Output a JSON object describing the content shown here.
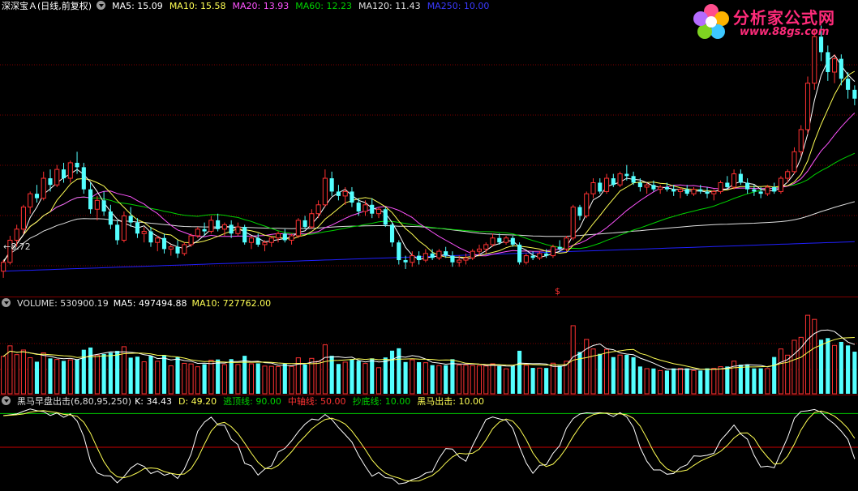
{
  "main_header": {
    "stock_name": "深深宝Ａ(日线,前复权)",
    "ma5": "MA5: 15.09",
    "ma10": "MA10: 15.58",
    "ma20": "MA20: 13.93",
    "ma60": "MA60: 12.23",
    "ma120": "MA120: 11.43",
    "ma250": "MA250: 10.00"
  },
  "volume_header": {
    "label": "VOLUME: 530900.19",
    "ma5": "MA5: 497494.88",
    "ma10": "MA10: 727762.00"
  },
  "indicator_header": {
    "label": "黑马早盘出击(6,80,95,250)",
    "k": "K: 34.43",
    "d": "D: 49.20",
    "top_line": "逃顶线: 90.00",
    "mid_line": "中轴线: 50.00",
    "bottom_line": "抄底线: 10.00",
    "signal": "黑马出击: 10.00"
  },
  "price_low_label": "8.72",
  "marker_label": "$",
  "logo": {
    "name": "分析家公式网",
    "url": "www.88gs.com"
  },
  "colors": {
    "up": "#ff3232",
    "down": "#54ffff",
    "ma5": "#ffffff",
    "ma10": "#ffff54",
    "ma20": "#ff54ff",
    "ma60": "#00d200",
    "ma120": "#e0e0e0",
    "ma250": "#2020ff",
    "grid": "#800000",
    "k_line": "#ffffff",
    "d_line": "#ffff54",
    "top_line": "#00c800",
    "mid_line": "#c80000"
  },
  "chart_data": [
    {
      "type": "candlestick",
      "title": "深深宝Ａ(日线,前复权)",
      "price_low": 8.72,
      "candles_ohlc": [
        [
          9.0,
          9.5,
          8.7,
          9.4
        ],
        [
          9.4,
          10.6,
          9.3,
          10.4
        ],
        [
          10.4,
          11.1,
          10.1,
          10.9
        ],
        [
          10.9,
          12.0,
          10.7,
          11.9
        ],
        [
          11.9,
          12.6,
          11.6,
          12.5
        ],
        [
          12.5,
          12.9,
          12.1,
          12.3
        ],
        [
          12.3,
          13.5,
          12.2,
          13.2
        ],
        [
          13.2,
          13.6,
          12.6,
          12.9
        ],
        [
          12.9,
          13.8,
          12.8,
          13.6
        ],
        [
          13.6,
          13.9,
          13.0,
          13.2
        ],
        [
          13.2,
          14.0,
          13.0,
          13.9
        ],
        [
          13.9,
          14.4,
          13.4,
          13.7
        ],
        [
          13.7,
          13.9,
          12.5,
          12.7
        ],
        [
          12.7,
          13.0,
          11.6,
          11.8
        ],
        [
          11.8,
          12.4,
          11.3,
          12.2
        ],
        [
          12.2,
          12.6,
          11.5,
          11.7
        ],
        [
          11.7,
          12.0,
          10.9,
          11.1
        ],
        [
          11.1,
          11.3,
          10.2,
          10.4
        ],
        [
          10.4,
          11.7,
          10.3,
          11.5
        ],
        [
          11.5,
          11.9,
          11.0,
          11.2
        ],
        [
          11.2,
          11.4,
          10.5,
          10.7
        ],
        [
          10.7,
          11.0,
          10.3,
          10.8
        ],
        [
          10.8,
          11.0,
          10.1,
          10.3
        ],
        [
          10.3,
          10.6,
          9.9,
          10.5
        ],
        [
          10.5,
          10.7,
          9.8,
          10.0
        ],
        [
          10.0,
          10.2,
          9.7,
          10.1
        ],
        [
          10.1,
          10.4,
          9.6,
          9.8
        ],
        [
          9.8,
          10.3,
          9.7,
          10.2
        ],
        [
          10.2,
          10.7,
          10.1,
          10.6
        ],
        [
          10.6,
          11.0,
          10.5,
          10.9
        ],
        [
          10.9,
          11.2,
          10.6,
          10.8
        ],
        [
          10.8,
          11.5,
          10.7,
          11.3
        ],
        [
          11.3,
          11.6,
          10.8,
          10.9
        ],
        [
          10.9,
          11.2,
          10.6,
          11.1
        ],
        [
          11.1,
          11.3,
          10.5,
          10.7
        ],
        [
          10.7,
          11.2,
          10.6,
          11.0
        ],
        [
          11.0,
          11.1,
          10.2,
          10.3
        ],
        [
          10.3,
          10.6,
          10.0,
          10.5
        ],
        [
          10.5,
          10.7,
          10.1,
          10.2
        ],
        [
          10.2,
          10.4,
          9.9,
          10.3
        ],
        [
          10.3,
          10.6,
          10.1,
          10.5
        ],
        [
          10.5,
          10.8,
          10.3,
          10.7
        ],
        [
          10.7,
          10.9,
          10.3,
          10.4
        ],
        [
          10.4,
          10.7,
          10.2,
          10.6
        ],
        [
          10.6,
          11.4,
          10.5,
          11.3
        ],
        [
          11.3,
          11.5,
          10.9,
          11.0
        ],
        [
          11.0,
          11.8,
          10.9,
          11.6
        ],
        [
          11.6,
          12.2,
          11.4,
          12.0
        ],
        [
          12.0,
          13.6,
          11.9,
          13.2
        ],
        [
          13.2,
          13.5,
          12.4,
          12.6
        ],
        [
          12.6,
          12.9,
          12.2,
          12.4
        ],
        [
          12.4,
          12.8,
          12.0,
          12.6
        ],
        [
          12.6,
          12.8,
          11.9,
          12.1
        ],
        [
          12.1,
          12.3,
          11.5,
          11.7
        ],
        [
          11.7,
          12.2,
          11.5,
          12.0
        ],
        [
          12.0,
          12.3,
          11.4,
          11.6
        ],
        [
          11.6,
          11.9,
          11.4,
          11.8
        ],
        [
          11.8,
          11.9,
          11.0,
          11.1
        ],
        [
          11.1,
          11.2,
          10.1,
          10.3
        ],
        [
          10.3,
          10.4,
          9.3,
          9.5
        ],
        [
          9.5,
          9.7,
          9.1,
          9.4
        ],
        [
          9.4,
          9.9,
          9.2,
          9.7
        ],
        [
          9.7,
          9.9,
          9.3,
          9.5
        ],
        [
          9.5,
          10.0,
          9.4,
          9.8
        ],
        [
          9.8,
          10.0,
          9.5,
          9.6
        ],
        [
          9.6,
          10.0,
          9.5,
          9.9
        ],
        [
          9.9,
          10.1,
          9.6,
          9.7
        ],
        [
          9.7,
          9.9,
          9.2,
          9.4
        ],
        [
          9.4,
          9.7,
          9.2,
          9.5
        ],
        [
          9.5,
          9.8,
          9.3,
          9.6
        ],
        [
          9.6,
          10.0,
          9.5,
          9.9
        ],
        [
          9.9,
          10.2,
          9.7,
          10.0
        ],
        [
          10.0,
          10.3,
          9.8,
          10.2
        ],
        [
          10.2,
          10.7,
          10.1,
          10.5
        ],
        [
          10.5,
          10.7,
          10.2,
          10.3
        ],
        [
          10.3,
          10.6,
          10.2,
          10.5
        ],
        [
          10.5,
          10.6,
          10.1,
          10.2
        ],
        [
          10.2,
          10.3,
          9.3,
          9.4
        ],
        [
          9.4,
          9.8,
          9.3,
          9.7
        ],
        [
          9.7,
          9.9,
          9.5,
          9.6
        ],
        [
          9.6,
          9.9,
          9.5,
          9.8
        ],
        [
          9.8,
          10.0,
          9.6,
          9.7
        ],
        [
          9.7,
          10.2,
          9.6,
          10.1
        ],
        [
          10.1,
          10.4,
          9.9,
          10.0
        ],
        [
          10.0,
          10.6,
          9.9,
          10.5
        ],
        [
          10.5,
          12.0,
          10.4,
          11.9
        ],
        [
          11.9,
          12.0,
          11.3,
          11.5
        ],
        [
          11.5,
          12.6,
          11.4,
          12.5
        ],
        [
          12.5,
          13.2,
          12.3,
          13.0
        ],
        [
          13.0,
          13.2,
          12.5,
          12.6
        ],
        [
          12.6,
          13.4,
          12.5,
          13.2
        ],
        [
          13.2,
          13.4,
          12.8,
          12.9
        ],
        [
          12.9,
          13.5,
          12.8,
          13.4
        ],
        [
          13.4,
          13.8,
          13.1,
          13.3
        ],
        [
          13.3,
          13.5,
          12.9,
          13.0
        ],
        [
          13.0,
          13.2,
          12.6,
          12.8
        ],
        [
          12.8,
          13.0,
          12.5,
          12.9
        ],
        [
          12.9,
          13.1,
          12.6,
          12.7
        ],
        [
          12.7,
          12.9,
          12.5,
          12.8
        ],
        [
          12.8,
          13.0,
          12.6,
          12.7
        ],
        [
          12.7,
          12.9,
          12.4,
          12.6
        ],
        [
          12.6,
          12.8,
          12.3,
          12.7
        ],
        [
          12.7,
          12.9,
          12.4,
          12.5
        ],
        [
          12.5,
          12.8,
          12.4,
          12.7
        ],
        [
          12.7,
          12.9,
          12.5,
          12.6
        ],
        [
          12.6,
          12.8,
          12.3,
          12.5
        ],
        [
          12.5,
          12.7,
          12.2,
          12.6
        ],
        [
          12.6,
          13.1,
          12.5,
          13.0
        ],
        [
          13.0,
          13.3,
          12.7,
          12.8
        ],
        [
          12.8,
          13.6,
          12.7,
          13.4
        ],
        [
          13.4,
          13.6,
          12.9,
          13.0
        ],
        [
          13.0,
          13.2,
          12.5,
          12.7
        ],
        [
          12.7,
          12.9,
          12.4,
          12.6
        ],
        [
          12.6,
          12.8,
          12.3,
          12.5
        ],
        [
          12.5,
          12.9,
          12.4,
          12.8
        ],
        [
          12.8,
          13.0,
          12.5,
          12.6
        ],
        [
          12.6,
          13.3,
          12.5,
          13.2
        ],
        [
          13.2,
          13.6,
          13.0,
          13.5
        ],
        [
          13.5,
          14.6,
          13.4,
          14.4
        ],
        [
          14.4,
          15.6,
          14.2,
          15.4
        ],
        [
          15.4,
          17.8,
          15.2,
          17.5
        ],
        [
          17.5,
          19.9,
          17.2,
          19.6
        ],
        [
          19.6,
          20.1,
          18.5,
          18.9
        ],
        [
          18.9,
          19.2,
          17.6,
          18.0
        ],
        [
          18.0,
          18.8,
          17.5,
          18.6
        ],
        [
          18.6,
          18.8,
          17.4,
          17.7
        ],
        [
          17.7,
          18.0,
          16.8,
          17.2
        ],
        [
          17.2,
          17.4,
          16.5,
          16.8
        ]
      ]
    },
    {
      "type": "bar",
      "title": "VOLUME",
      "volume_last": 530900.19,
      "ma5": 497494.88,
      "ma10": 727762.0
    },
    {
      "type": "line",
      "title": "黑马早盘出击(6,80,95,250)",
      "k": 34.43,
      "d": 49.2,
      "levels": {
        "逃顶线": 90.0,
        "中轴线": 50.0,
        "抄底线": 10.0,
        "黑马出击": 10.0
      }
    }
  ]
}
